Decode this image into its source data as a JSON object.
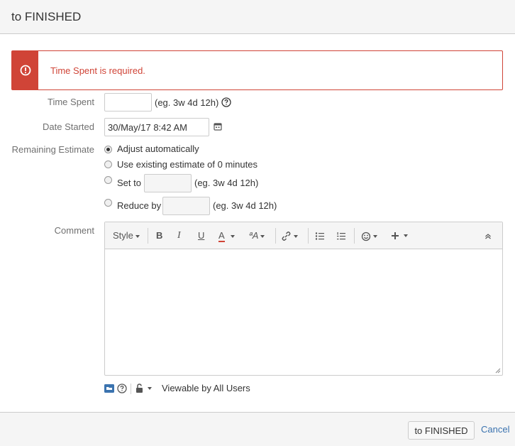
{
  "dialog": {
    "title": "to FINISHED"
  },
  "error": {
    "message": "Time Spent is required.",
    "color": "#d04437"
  },
  "form": {
    "time_spent": {
      "label": "Time Spent",
      "value": "",
      "hint": "(eg. 3w 4d 12h)"
    },
    "date_started": {
      "label": "Date Started",
      "value": "30/May/17 8:42 AM"
    },
    "remaining_estimate": {
      "label": "Remaining Estimate",
      "options": [
        {
          "label": "Adjust automatically",
          "checked": true
        },
        {
          "label": "Use existing estimate of 0 minutes",
          "checked": false
        },
        {
          "label": "Set to",
          "checked": false,
          "hint": "(eg. 3w 4d 12h)"
        },
        {
          "label": "Reduce by",
          "checked": false,
          "hint": "(eg. 3w 4d 12h)"
        }
      ]
    },
    "comment": {
      "label": "Comment",
      "toolbar": {
        "style": "Style",
        "bold": "B",
        "italic": "I",
        "underline": "U",
        "text_color": "A",
        "text_style": "ªA"
      },
      "value": ""
    },
    "viewable": "Viewable by All Users"
  },
  "actions": {
    "submit": "to FINISHED",
    "cancel": "Cancel"
  },
  "colors": {
    "link": "#3b73af",
    "error": "#d04437"
  }
}
